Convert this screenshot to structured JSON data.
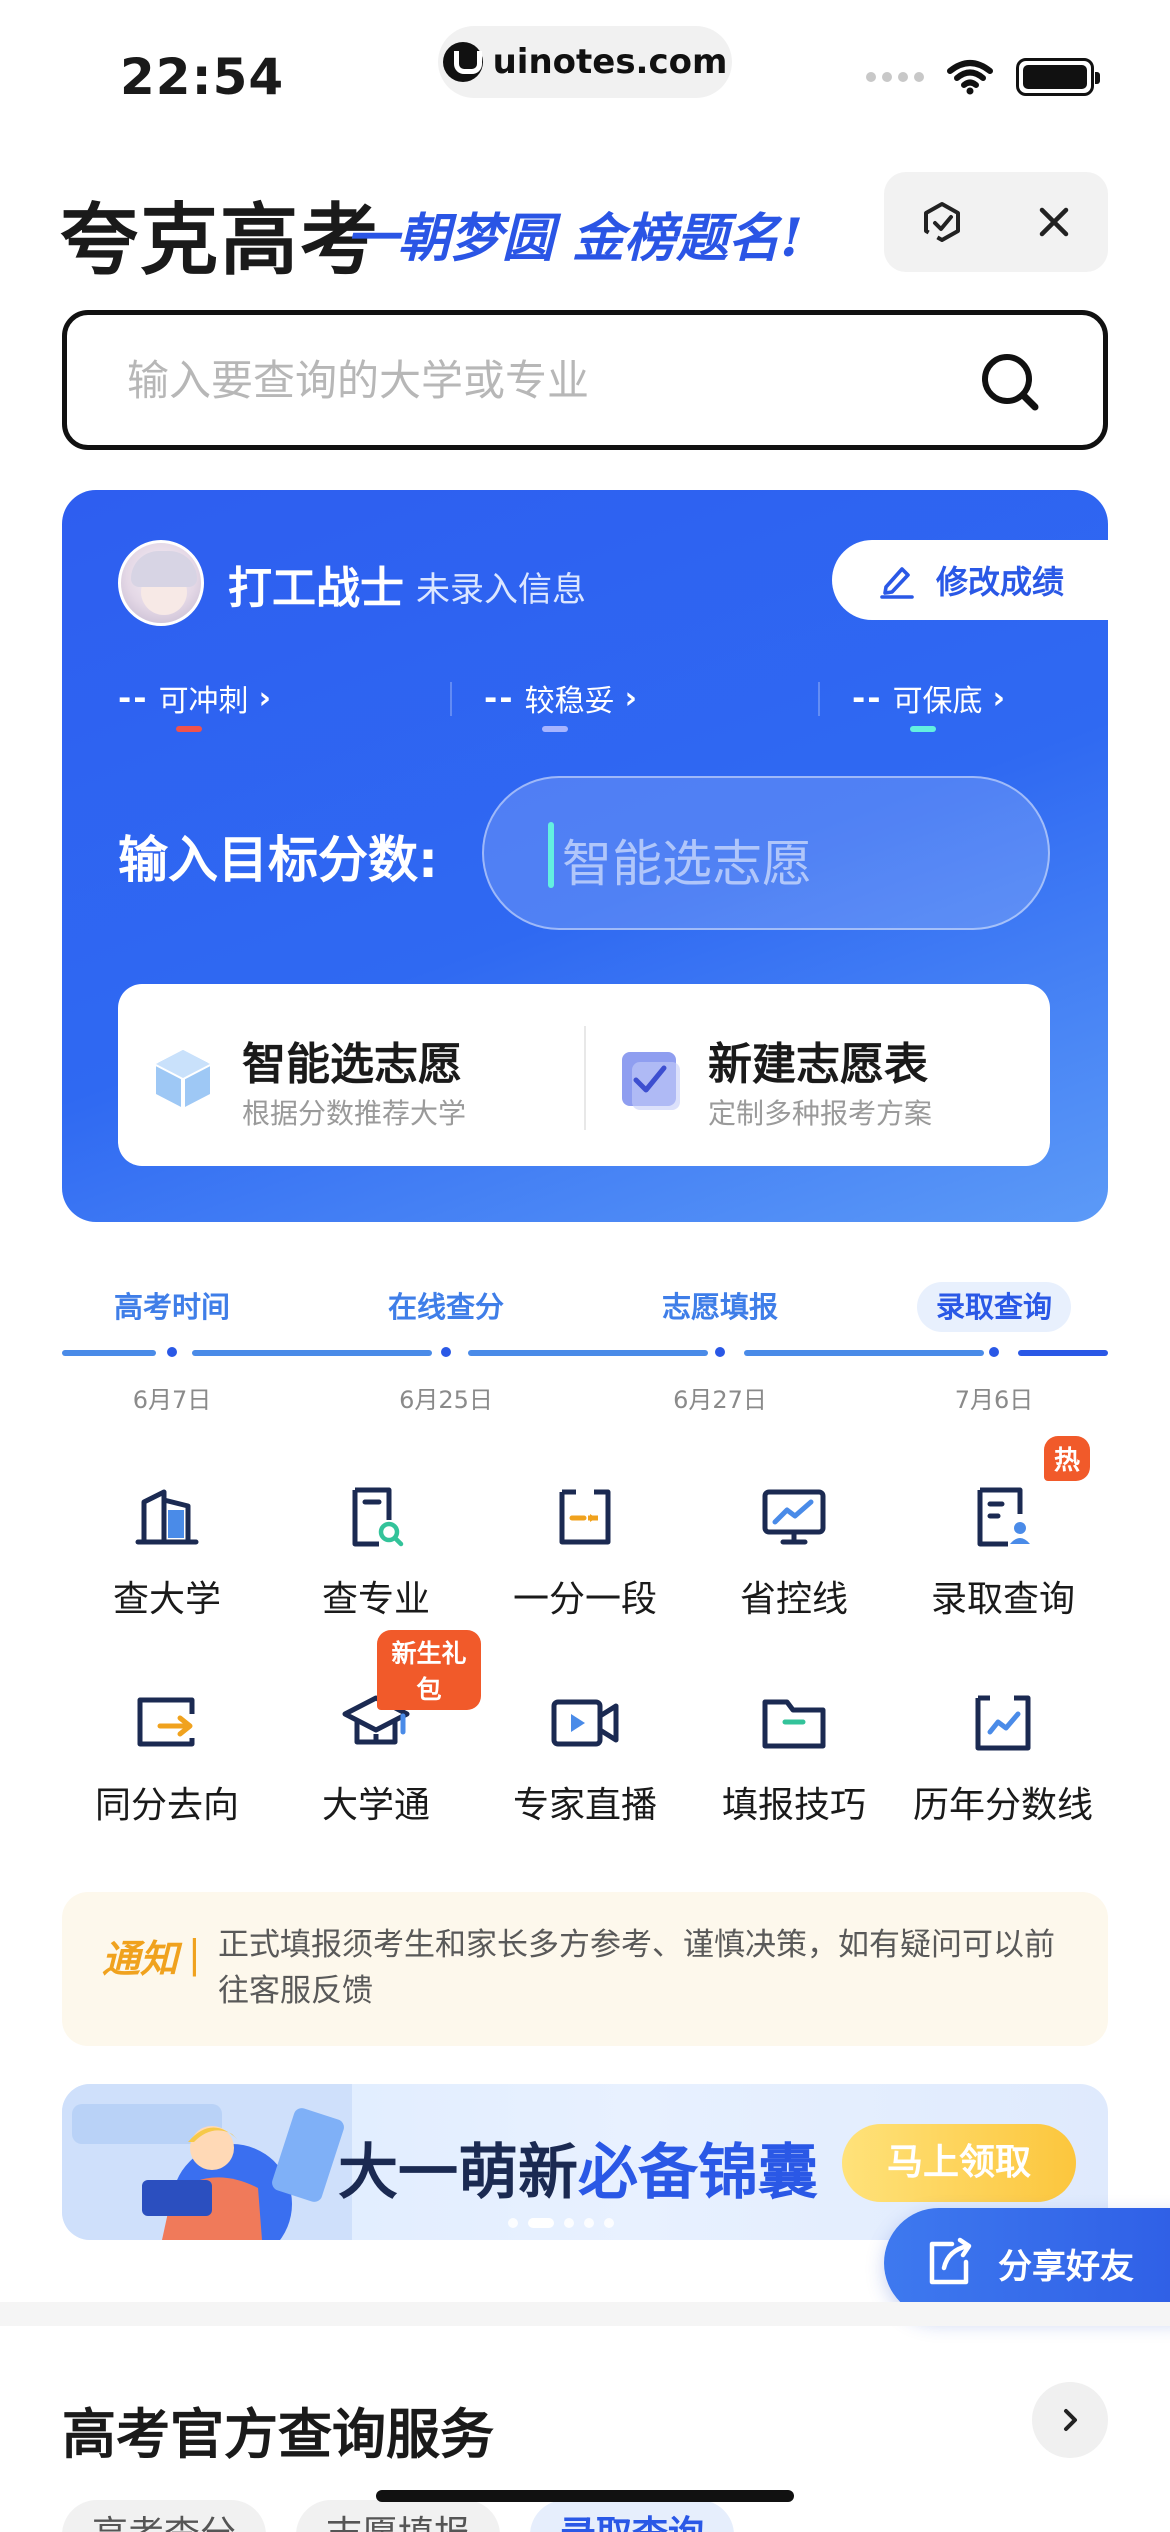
{
  "status_bar": {
    "time": "22:54",
    "url": "uinotes.com"
  },
  "header": {
    "app_title": "夸克高考",
    "slogan": "一朝梦圆 金榜题名!"
  },
  "search": {
    "placeholder": "输入要查询的大学或专业"
  },
  "profile": {
    "name": "打工战士",
    "info": "未录入信息",
    "edit_label": "修改成绩",
    "tiers": [
      {
        "dash": "--",
        "label": "可冲刺",
        "color": "#f0524b"
      },
      {
        "dash": "--",
        "label": "较稳妥",
        "color": "#a6b4ff"
      },
      {
        "dash": "--",
        "label": "可保底",
        "color": "#63f0e0"
      }
    ],
    "target_label": "输入目标分数:",
    "target_placeholder": "智能选志愿",
    "actions": [
      {
        "title": "智能选志愿",
        "subtitle": "根据分数推荐大学"
      },
      {
        "title": "新建志愿表",
        "subtitle": "定制多种报考方案"
      }
    ]
  },
  "timeline": [
    {
      "label": "高考时间",
      "date": "6月7日",
      "active": false
    },
    {
      "label": "在线查分",
      "date": "6月25日",
      "active": false
    },
    {
      "label": "志愿填报",
      "date": "6月27日",
      "active": false
    },
    {
      "label": "录取查询",
      "date": "7月6日",
      "active": true
    }
  ],
  "grid": [
    {
      "label": "查大学",
      "icon": "building-icon"
    },
    {
      "label": "查专业",
      "icon": "document-search-icon"
    },
    {
      "label": "一分一段",
      "icon": "score-segment-icon"
    },
    {
      "label": "省控线",
      "icon": "monitor-chart-icon"
    },
    {
      "label": "录取查询",
      "icon": "admission-doc-icon",
      "badge": "热"
    },
    {
      "label": "同分去向",
      "icon": "export-arrow-icon"
    },
    {
      "label": "大学通",
      "icon": "graduation-cap-icon",
      "badge": "新生礼包"
    },
    {
      "label": "专家直播",
      "icon": "video-camera-icon"
    },
    {
      "label": "填报技巧",
      "icon": "folder-icon"
    },
    {
      "label": "历年分数线",
      "icon": "calendar-chart-icon"
    }
  ],
  "notice": {
    "tag": "通知",
    "separator": "|",
    "text": "正式填报须考生和家长多方参考、谨慎决策，如有疑问可以前往客服反馈"
  },
  "banner": {
    "text_dark": "大一萌新",
    "text_blue": "必备锦囊",
    "button": "马上领取"
  },
  "share": {
    "label": "分享好友"
  },
  "section": {
    "title": "高考官方查询服务"
  },
  "chips": [
    "高考查分",
    "志愿填报",
    "录取查询"
  ],
  "colors": {
    "primary": "#2a58e6",
    "accent_orange": "#f15a2a",
    "notice_gold": "#f0a21e"
  }
}
